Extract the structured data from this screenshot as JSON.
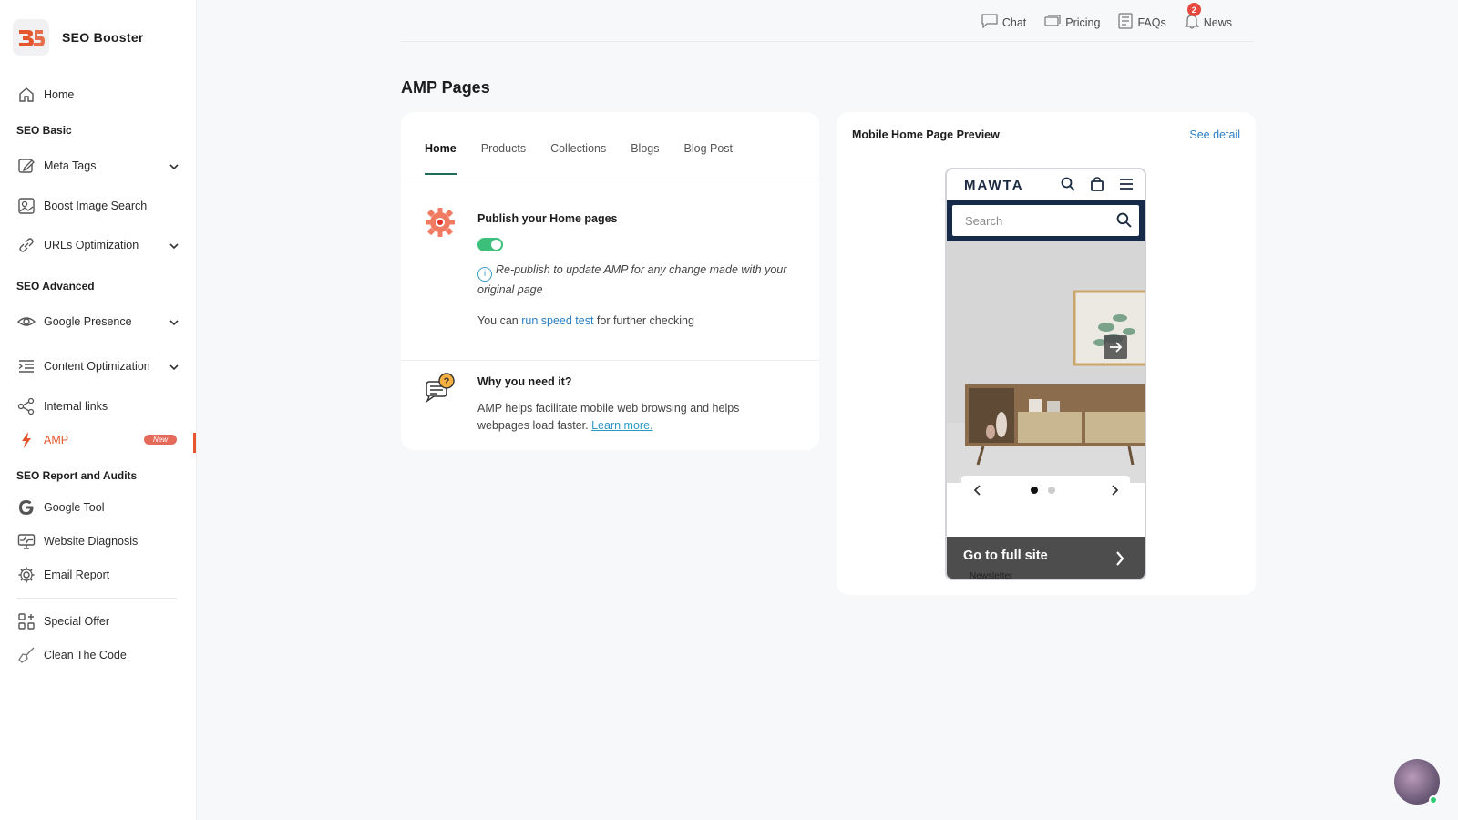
{
  "brand": {
    "name": "SEO Booster"
  },
  "sidebar": {
    "home": "Home",
    "section_basic": "SEO Basic",
    "meta_tags": "Meta Tags",
    "boost_image": "Boost Image Search",
    "urls_opt": "URLs Optimization",
    "section_advanced": "SEO Advanced",
    "google_presence": "Google Presence",
    "content_opt": "Content Optimization",
    "internal_links": "Internal links",
    "amp": "AMP",
    "amp_badge": "New",
    "section_report": "SEO Report and Audits",
    "google_tool": "Google Tool",
    "website_diagnosis": "Website Diagnosis",
    "email_report": "Email Report",
    "special_offer": "Special Offer",
    "clean_code": "Clean The Code"
  },
  "topbar": {
    "chat": "Chat",
    "pricing": "Pricing",
    "faqs": "FAQs",
    "news": "News",
    "news_count": "2"
  },
  "page": {
    "title": "AMP Pages"
  },
  "tabs": [
    "Home",
    "Products",
    "Collections",
    "Blogs",
    "Blog Post"
  ],
  "publish": {
    "title": "Publish your Home pages",
    "toggle_on": true,
    "note": "Re-publish to update AMP for any change made with your original page",
    "speed_prefix": "You can ",
    "speed_link": "run speed test",
    "speed_suffix": " for further checking"
  },
  "why": {
    "title": "Why you need it?",
    "text": "AMP helps facilitate mobile web browsing and helps webpages load faster. ",
    "learn_more": "Learn more."
  },
  "preview": {
    "title": "Mobile Home Page Preview",
    "see_detail": "See detail",
    "store_logo": "MAWTA",
    "search_placeholder": "Search",
    "cta": "Go to full site",
    "cta_sub": "Newsletter"
  },
  "colors": {
    "accent": "#e4572e",
    "toggle": "#3dbf7c",
    "link": "#2a7fc4",
    "tab_underline": "#1f6e5a"
  }
}
